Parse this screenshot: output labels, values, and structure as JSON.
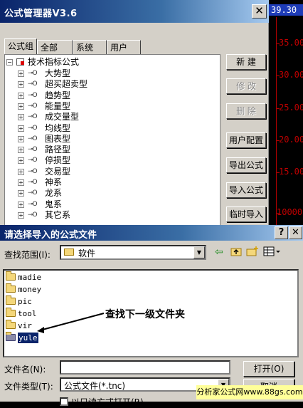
{
  "chart_axis": {
    "price_box": "39.30",
    "ticks": [
      "35.00",
      "30.00",
      "25.00",
      "20.00",
      "15.00",
      "10000"
    ]
  },
  "formula_manager": {
    "title": "公式管理器V3.6",
    "close_glyph": "✕",
    "tabs": [
      "公式组",
      "全部",
      "系统",
      "用户"
    ],
    "tree_root": "技术指标公式",
    "tree_items": [
      "大势型",
      "超买超卖型",
      "趋势型",
      "能量型",
      "成交量型",
      "均线型",
      "图表型",
      "路径型",
      "停损型",
      "交易型",
      "神系",
      "龙系",
      "鬼系",
      "其它系"
    ],
    "tree_key_glyph": "⊸O",
    "buttons": [
      {
        "label": "新  建",
        "enabled": true
      },
      {
        "label": "修  改",
        "enabled": false
      },
      {
        "label": "删  除",
        "enabled": false
      },
      {
        "label": "用户配置",
        "enabled": true
      },
      {
        "label": "导出公式",
        "enabled": true
      },
      {
        "label": "导入公式",
        "enabled": true
      },
      {
        "label": "临时导入",
        "enabled": true
      }
    ]
  },
  "open_dialog": {
    "title": "请选择导入的公式文件",
    "help_glyph": "?",
    "close_glyph": "✕",
    "lookin_label": "查找范围(I):",
    "lookin_value": "软件",
    "toolbar_icons": [
      "back-arrow-icon",
      "up-folder-icon",
      "new-folder-icon",
      "view-menu-icon"
    ],
    "folders": [
      "madie",
      "money",
      "pic",
      "tool",
      "vir",
      "yule"
    ],
    "selected_folder": "yule",
    "annotation": "查找下一级文件夹",
    "filename_label": "文件名(N):",
    "filename_value": "",
    "filetype_label": "文件类型(T):",
    "filetype_value": "公式文件(*.tnc)",
    "open_button": "打开(O)",
    "cancel_button": "取消",
    "readonly_label": "以只读方式打开(R)"
  },
  "watermark": "分析家公式网www.88gs.com",
  "colors": {
    "title_gradient_start": "#0a246a",
    "title_gradient_end": "#a6caf0",
    "dialog_face": "#d4d0c8",
    "axis_red": "#c00000",
    "price_box_blue": "#1e3cb8",
    "selection": "#0a246a"
  }
}
